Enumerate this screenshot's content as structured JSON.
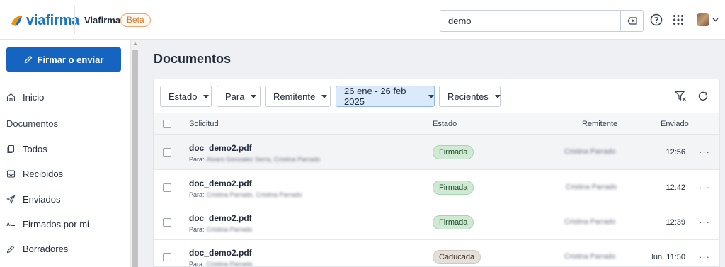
{
  "header": {
    "logo_text": "viafirma",
    "app_name": "Viafirma",
    "beta_label": "Beta",
    "search_value": "demo"
  },
  "sidebar": {
    "primary_button": "Firmar o enviar",
    "items": [
      {
        "label": "Inicio",
        "icon": "home-icon"
      },
      {
        "label": "Todos",
        "icon": "documents-icon"
      },
      {
        "label": "Recibidos",
        "icon": "inbox-icon"
      },
      {
        "label": "Enviados",
        "icon": "send-icon"
      },
      {
        "label": "Firmados por mi",
        "icon": "signature-icon"
      },
      {
        "label": "Borradores",
        "icon": "pencil-icon"
      }
    ],
    "section_label": "Documentos"
  },
  "main": {
    "title": "Documentos",
    "filters": {
      "estado": "Estado",
      "para": "Para",
      "remitente": "Remitente",
      "date_range": "26 ene - 26 feb 2025",
      "recientes": "Recientes"
    },
    "columns": {
      "solicitud": "Solicitud",
      "estado": "Estado",
      "remitente": "Remitente",
      "enviado": "Enviado"
    },
    "rows": [
      {
        "file": "doc_demo2.pdf",
        "para_label": "Para:",
        "recipients": "Alvaro Gonzalez Serra, Cristina Parrado",
        "status": "Firmada",
        "sender": "Cristina Parrado",
        "sent": "12:56"
      },
      {
        "file": "doc_demo2.pdf",
        "para_label": "Para:",
        "recipients": "Cristina Parrado, Cristina Parrado",
        "status": "Firmada",
        "sender": "Cristina Parrado",
        "sent": "12:42"
      },
      {
        "file": "doc_demo2.pdf",
        "para_label": "Para:",
        "recipients": "Cristina Parrado",
        "status": "Firmada",
        "sender": "Cristina Parrado",
        "sent": "12:39"
      },
      {
        "file": "doc_demo2.pdf",
        "para_label": "Para:",
        "recipients": "Cristina Parrado",
        "status": "Caducada",
        "sender": "Cristina Parrado",
        "sent": "lun. 11:50"
      }
    ],
    "more_label": "···"
  },
  "colors": {
    "brand_blue": "#1565c0",
    "signed_badge": "#cfe9d3",
    "expired_badge": "#e5dfda",
    "beta_orange": "#d97a2b"
  }
}
